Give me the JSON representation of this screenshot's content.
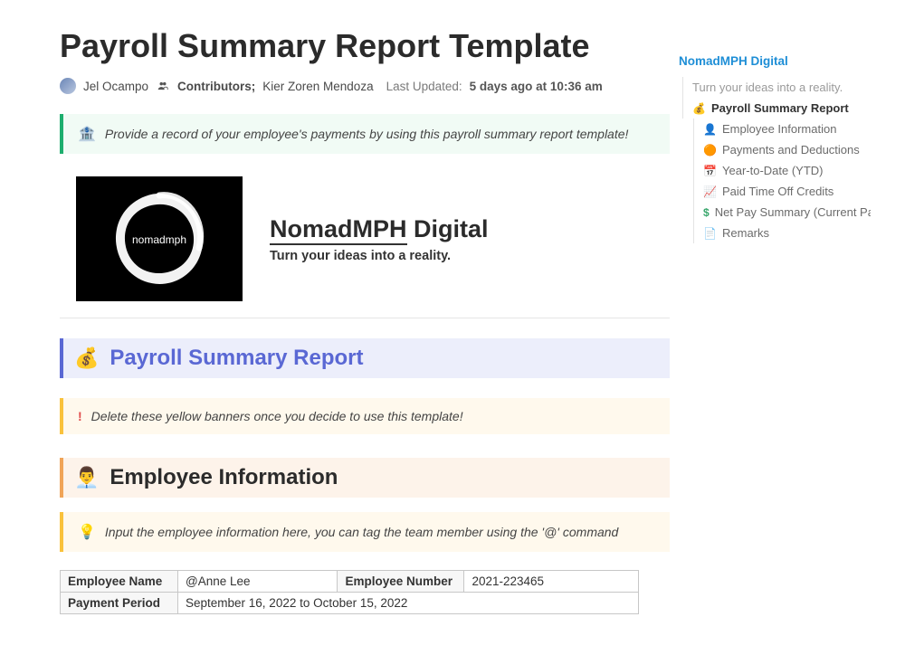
{
  "page": {
    "title": "Payroll Summary Report Template",
    "author": "Jel Ocampo",
    "contributors_label": "Contributors;",
    "contributors": "Kier Zoren Mendoza",
    "updated_label": "Last Updated:",
    "updated_value": "5 days ago at 10:36 am"
  },
  "intro_banner": {
    "icon": "🏦",
    "text": "Provide a record of your employee's payments by using this payroll summary report template!"
  },
  "brand": {
    "logo_text": "nomadmph",
    "name_part1": "NomadMPH",
    "name_part2": " Digital",
    "tagline": "Turn your ideas into a reality."
  },
  "sections": {
    "summary": {
      "icon": "💰",
      "title": "Payroll Summary Report"
    },
    "delete_banner": {
      "icon": "!",
      "text": "Delete these yellow banners once you decide to use this template!"
    },
    "employee_info": {
      "icon": "👨‍💼",
      "title": "Employee Information"
    },
    "emp_hint": {
      "icon": "💡",
      "text": "Input the employee information here, you can tag the team member using the '@' command"
    }
  },
  "employee_table": {
    "name_label": "Employee Name",
    "name_value": "@Anne Lee",
    "number_label": "Employee Number",
    "number_value": "2021-223465",
    "period_label": "Payment Period",
    "period_value": "September 16, 2022 to October 15, 2022"
  },
  "sidebar": {
    "top": "NomadMPH Digital",
    "tagline": "Turn your ideas into a reality.",
    "items": [
      {
        "icon": "💰",
        "label": "Payroll Summary Report",
        "active": true
      },
      {
        "icon": "👤",
        "label": "Employee Information"
      },
      {
        "icon": "🟠",
        "label": "Payments and Deductions"
      },
      {
        "icon": "📅",
        "label": "Year-to-Date (YTD)"
      },
      {
        "icon": "📈",
        "label": "Paid Time Off Credits"
      },
      {
        "icon": "$",
        "label": "Net Pay Summary (Current Pay Pe..."
      },
      {
        "icon": "📄",
        "label": "Remarks"
      }
    ]
  }
}
